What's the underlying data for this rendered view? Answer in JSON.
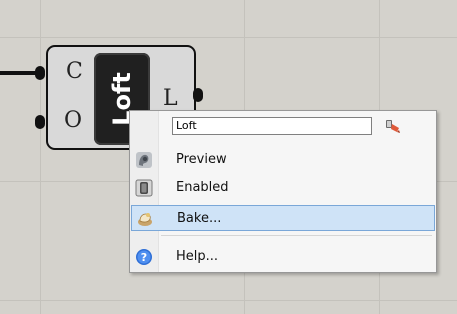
{
  "component": {
    "name": "Loft",
    "inputs": [
      "C",
      "O"
    ],
    "outputs": [
      "L"
    ]
  },
  "context_menu": {
    "name_field_value": "Loft",
    "items": [
      {
        "label": "Preview",
        "icon": "preview-icon"
      },
      {
        "label": "Enabled",
        "icon": "enabled-icon"
      },
      {
        "label": "Bake...",
        "icon": "bake-icon",
        "state": "highlighted"
      },
      {
        "label": "Help...",
        "icon": "help-icon"
      }
    ]
  }
}
